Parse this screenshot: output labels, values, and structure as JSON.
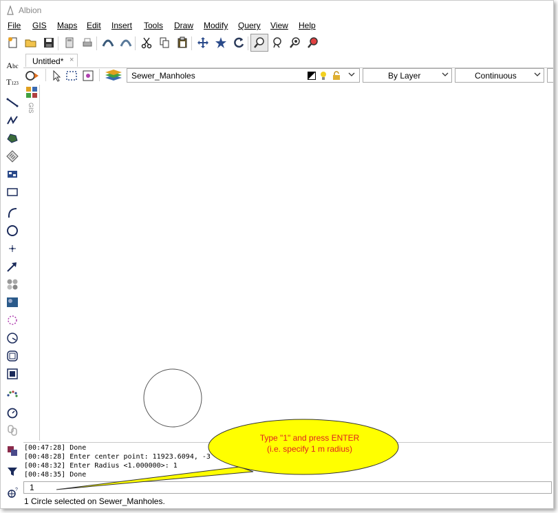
{
  "window": {
    "title": "Albion"
  },
  "menu": [
    "File",
    "GIS",
    "Maps",
    "Edit",
    "Insert",
    "Tools",
    "Draw",
    "Modify",
    "Query",
    "View",
    "Help"
  ],
  "toolbar_icons": [
    "new-icon",
    "open-icon",
    "save-icon",
    "page-icon",
    "print-icon",
    "undo-icon",
    "redo-icon",
    "cut-icon",
    "copy-icon",
    "paste-icon",
    "pan-icon",
    "star-icon",
    "refresh-icon",
    "zoom-window-icon",
    "zoom-lasso-icon",
    "zoom-extents-icon",
    "zoom-previous-icon"
  ],
  "tab": {
    "label": "Untitled*",
    "close": "×"
  },
  "layer": {
    "name": "Sewer_Manholes",
    "color": "By Layer",
    "linetype": "Continuous"
  },
  "gis_panel": {
    "label": "GIS"
  },
  "left_tools": [
    "text-icon",
    "text-style-icon",
    "line-icon",
    "polyline-icon",
    "polygon-icon",
    "hatch-icon",
    "block-icon",
    "rectangle-icon",
    "arc-icon",
    "circle-icon",
    "point-icon",
    "arrow-icon",
    "pattern-icon",
    "image-icon",
    "selection-icon",
    "dimension-icon",
    "offset-icon",
    "explode-icon",
    "points-icon",
    "clock-icon",
    "link-icon",
    "layers-icon",
    "filter-icon",
    "snap-icon"
  ],
  "console": {
    "lines": [
      "[00:47:28] Done",
      "[00:48:28] Enter center point: 11923.6094, -3",
      "[00:48:32] Enter Radius <1.000000>: 1",
      "[00:48:35] Done"
    ]
  },
  "command_input": {
    "value": "1"
  },
  "status": {
    "text": "1 Circle selected on Sewer_Manholes."
  },
  "callout": {
    "line1": "Type \"1\" and press  ENTER",
    "line2": "(i.e. specify 1 m radius)",
    "fill": "#ffff00",
    "text_color": "#e02020"
  }
}
